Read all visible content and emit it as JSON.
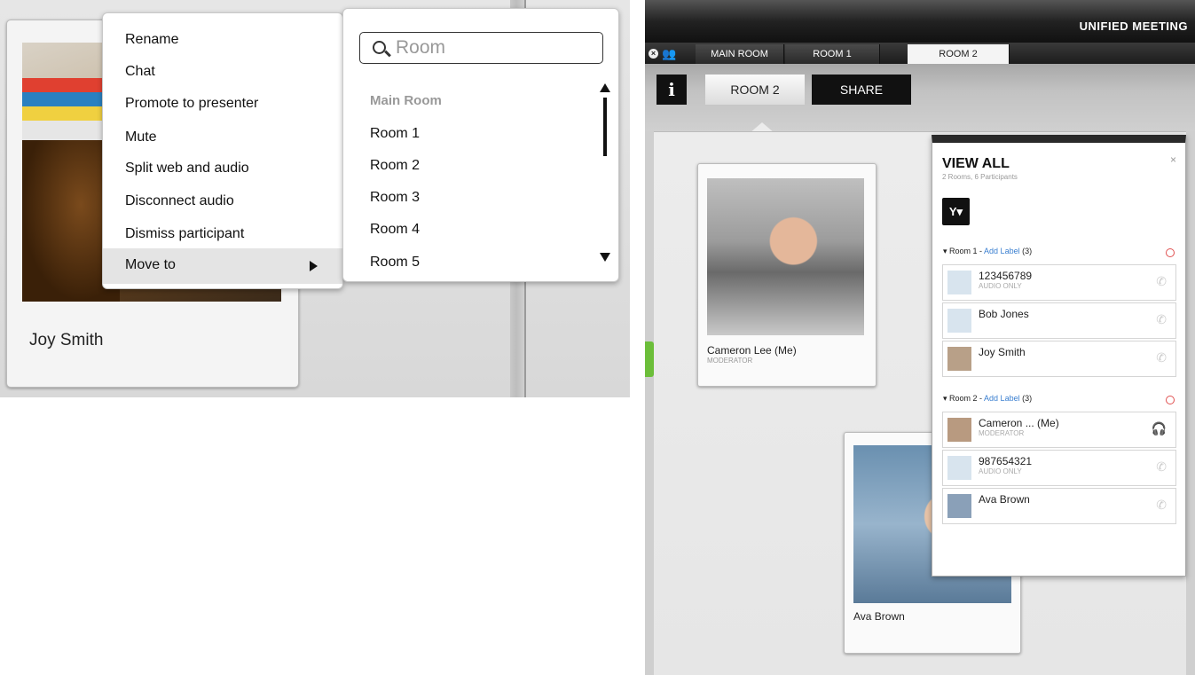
{
  "left": {
    "participant_name": "Joy Smith",
    "context_menu": {
      "items": [
        "Rename",
        "Chat",
        "Promote to presenter",
        "Mute",
        "Split web and audio",
        "Disconnect audio",
        "Dismiss participant",
        "Move to"
      ]
    },
    "submenu": {
      "search_placeholder": "Room",
      "header": "Main Room",
      "rooms": [
        "Room 1",
        "Room 2",
        "Room 3",
        "Room 4",
        "Room 5"
      ]
    }
  },
  "right": {
    "brand": "UNIFIED MEETING",
    "tabs": [
      "MAIN ROOM",
      "ROOM 1",
      "ROOM 2"
    ],
    "active_tab": "ROOM 2",
    "toolbar": {
      "info": "i",
      "room_label": "ROOM 2",
      "share": "SHARE"
    },
    "participants_canvas": [
      {
        "name": "Cameron Lee (Me)",
        "role": "MODERATOR"
      },
      {
        "name": "Ava Brown",
        "role": ""
      }
    ],
    "view_all": {
      "title": "VIEW ALL",
      "subtitle": "2 Rooms, 6 Participants",
      "close": "×",
      "groups": [
        {
          "name": "Room 1 - ",
          "link": "Add Label",
          "count": "(3)",
          "participants": [
            {
              "name": "123456789",
              "sub": "AUDIO ONLY"
            },
            {
              "name": "Bob Jones",
              "sub": ""
            },
            {
              "name": "Joy Smith",
              "sub": ""
            }
          ]
        },
        {
          "name": "Room 2 - ",
          "link": "Add Label",
          "count": "(3)",
          "participants": [
            {
              "name": "Cameron ... (Me)",
              "sub": "MODERATOR"
            },
            {
              "name": "987654321",
              "sub": "AUDIO ONLY"
            },
            {
              "name": "Ava Brown",
              "sub": ""
            }
          ]
        }
      ]
    }
  },
  "colors": {
    "accent_link": "#3a7fd0",
    "status_red": "#e05050",
    "side_tab": "#6cbe3a"
  }
}
